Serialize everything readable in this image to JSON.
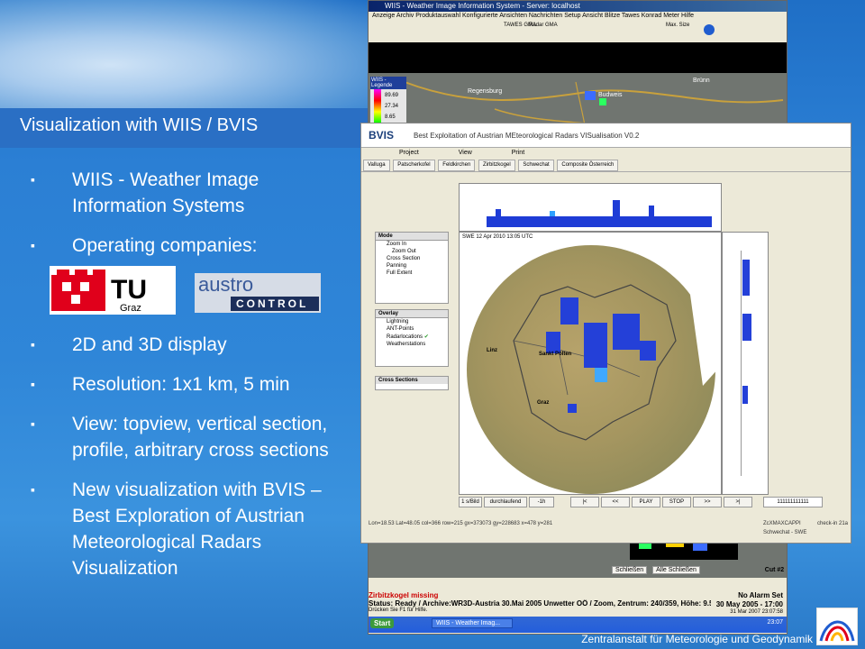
{
  "slide": {
    "title": "Visualization with WIIS / BVIS",
    "bullets_top": [
      "WIIS - Weather Image Information Systems",
      "Operating companies:"
    ],
    "logos": [
      "TU Graz",
      "austro CONTROL"
    ],
    "bullets_bottom": [
      "2D and 3D display",
      "Resolution: 1x1 km, 5 min",
      "View: topview,  vertical section, profile, arbitrary cross sections",
      "New visualization with BVIS – Best Exploration of Austrian Meteorological Radars Visualization"
    ],
    "footer": "Zentralanstalt für Meteorologie und Geodynamik"
  },
  "wiis": {
    "title": "WIIS - Weather Image Information System - Server: localhost",
    "menu": "Anzeige  Archiv  Produktauswahl  Konfigurierte Ansichten  Nachrichten  Setup  Ansicht  Blitze  Tawes  Konrad  Meter  Hilfe",
    "tools": [
      "TAWES GMA",
      "Radar GMA",
      "Max. Size"
    ],
    "legend_title": "WIIS - Legende",
    "legend_values": [
      "89.69",
      "27.34",
      "8.65"
    ],
    "places": [
      "Regensburg",
      "Budweis",
      "Brünn"
    ],
    "missing": "Zirbitzkogel missing",
    "no_alarm": "No Alarm Set",
    "status": "Status: Ready / Archive:WR3D-Austria 30.Mai 2005 Unwetter OÖ / Zoom, Zentrum: 240/359, Höhe: 9.5 km",
    "time": "30 May 2005 - 17:00",
    "help": "Drücken Sie F1 für Hilfe.",
    "buttons": [
      "Schließen",
      "Alle Schließen"
    ],
    "cut": "Cut #2",
    "start": "Start",
    "task": "WIIS - Weather Imag...",
    "clock": "23:07",
    "date": "31 Mar 2007  23:07:58"
  },
  "bvis": {
    "brand": "BVIS",
    "subtitle": "Best Exploitation of Austrian MEteorological Radars VISualisation V0.2",
    "menu": [
      "Project",
      "View",
      "Print"
    ],
    "tabs": [
      "Valluga",
      "Patscherkofel",
      "Feldkirchen",
      "Zirbitzkogel",
      "Schwechat",
      "Composite Österreich"
    ],
    "mode": {
      "header": "Mode",
      "items": [
        "Zoom In",
        "Zoom Out",
        "Cross Section",
        "Panning",
        "Full Extent"
      ]
    },
    "overlay": {
      "header": "Overlay",
      "items": [
        "Lightning",
        "ANT-Points",
        "Radarlocations",
        "Weatherstations"
      ]
    },
    "cross_sections": "Cross Sections",
    "map_label": "SWE 12 Apr 2010 13:05 UTC",
    "cities": [
      "Linz",
      "Sankt Pölten",
      "Graz"
    ],
    "controls": [
      "1 s/Bild",
      "durchlaufend",
      "-1h",
      "|<",
      "<<",
      "PLAY",
      "STOP",
      ">>",
      ">|"
    ],
    "code": "111111111111",
    "status": "Lon=18.53 Lat=48.05 col=366 row=215 gx=373073 gy=228683 x=478 y=281",
    "product": "ZcXMAXCAPPI",
    "check": "check-in 21a",
    "site": "Schwechat - SWE"
  }
}
